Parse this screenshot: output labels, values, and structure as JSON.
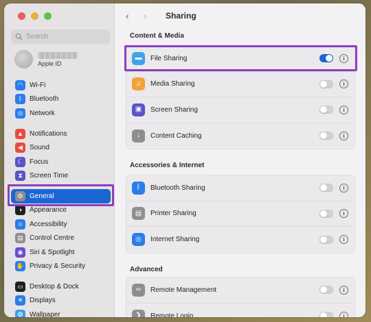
{
  "window": {
    "title": "Sharing"
  },
  "sidebar": {
    "search_placeholder": "Search",
    "account": {
      "subtitle": "Apple ID"
    },
    "groups": [
      [
        {
          "label": "Wi-Fi",
          "icon": "wifi-icon",
          "color": "#2b7de9"
        },
        {
          "label": "Bluetooth",
          "icon": "bluetooth-icon",
          "color": "#2b7de9"
        },
        {
          "label": "Network",
          "icon": "globe-icon",
          "color": "#2b7de9"
        }
      ],
      [
        {
          "label": "Notifications",
          "icon": "bell-icon",
          "color": "#eb4b3f"
        },
        {
          "label": "Sound",
          "icon": "speaker-icon",
          "color": "#eb4b3f"
        },
        {
          "label": "Focus",
          "icon": "moon-icon",
          "color": "#5a53c9"
        },
        {
          "label": "Screen Time",
          "icon": "hourglass-icon",
          "color": "#5a53c9"
        }
      ],
      [
        {
          "label": "General",
          "icon": "gear-icon",
          "color": "#8e8d90",
          "active": true
        },
        {
          "label": "Appearance",
          "icon": "appearance-icon",
          "color": "#1f1f1f"
        },
        {
          "label": "Accessibility",
          "icon": "accessibility-icon",
          "color": "#2b7de9"
        },
        {
          "label": "Control Centre",
          "icon": "control-centre-icon",
          "color": "#8e8d90"
        },
        {
          "label": "Siri & Spotlight",
          "icon": "siri-icon",
          "color": "#6b4bd1"
        },
        {
          "label": "Privacy & Security",
          "icon": "hand-icon",
          "color": "#2b7de9"
        }
      ],
      [
        {
          "label": "Desktop & Dock",
          "icon": "dock-icon",
          "color": "#1f1f1f"
        },
        {
          "label": "Displays",
          "icon": "display-icon",
          "color": "#2b7de9"
        },
        {
          "label": "Wallpaper",
          "icon": "wallpaper-icon",
          "color": "#3aa0e8"
        }
      ]
    ]
  },
  "main": {
    "sections": [
      {
        "title": "Content & Media",
        "rows": [
          {
            "label": "File Sharing",
            "icon": "folder-icon",
            "color": "#3fa3e8",
            "on": true
          },
          {
            "label": "Media Sharing",
            "icon": "music-icon",
            "color": "#f1a23a",
            "on": false
          },
          {
            "label": "Screen Sharing",
            "icon": "screen-sharing-icon",
            "color": "#5a53c9",
            "on": false
          },
          {
            "label": "Content Caching",
            "icon": "download-icon",
            "color": "#8e8d90",
            "on": false
          }
        ]
      },
      {
        "title": "Accessories & Internet",
        "rows": [
          {
            "label": "Bluetooth Sharing",
            "icon": "bluetooth-icon",
            "color": "#2b7de9",
            "on": false
          },
          {
            "label": "Printer Sharing",
            "icon": "printer-icon",
            "color": "#8e8d90",
            "on": false
          },
          {
            "label": "Internet Sharing",
            "icon": "globe-icon",
            "color": "#2b7de9",
            "on": false
          }
        ]
      },
      {
        "title": "Advanced",
        "rows": [
          {
            "label": "Remote Management",
            "icon": "binoculars-icon",
            "color": "#8e8d90",
            "on": false
          },
          {
            "label": "Remote Login",
            "icon": "terminal-icon",
            "color": "#8e8d90",
            "on": false
          }
        ]
      }
    ]
  }
}
